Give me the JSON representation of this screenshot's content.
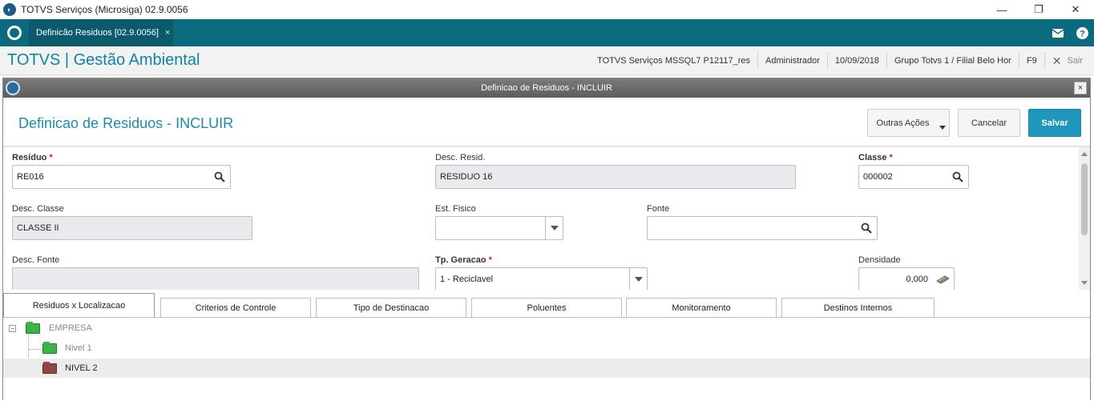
{
  "window": {
    "title": "TOTVS Serviços (Microsiga) 02.9.0056",
    "minimize": "—",
    "maximize": "❐",
    "close": "✕"
  },
  "tabbar": {
    "active_tab": "Definicão Residuos [02.9.0056]",
    "tab_close": "×"
  },
  "header": {
    "brand": "TOTVS | Gestão Ambiental",
    "environment": "TOTVS Serviços MSSQL7 P12117_res",
    "user": "Administrador",
    "date": "10/09/2018",
    "branch": "Grupo Totvs 1 / Filial Belo Hor",
    "shortcut": "F9",
    "exit_icon": "✕",
    "exit_label": "Sair"
  },
  "dialog": {
    "title": "Definicao de Residuos - INCLUIR",
    "close": "×",
    "form_title": "Definicao de Residuos - INCLUIR",
    "buttons": {
      "more_actions": "Outras Ações",
      "cancel": "Cancelar",
      "save": "Salvar"
    }
  },
  "fields": {
    "residuo": {
      "label": "Resíduo",
      "required": "*",
      "value": "RE016"
    },
    "desc_resid": {
      "label": "Desc. Resid.",
      "value": "RESIDUO 16"
    },
    "classe": {
      "label": "Classe",
      "required": "*",
      "value": "000002"
    },
    "desc_classe": {
      "label": "Desc. Classe",
      "value": "CLASSE II"
    },
    "est_fisico": {
      "label": "Est. Fisico",
      "value": ""
    },
    "fonte": {
      "label": "Fonte",
      "value": ""
    },
    "desc_fonte": {
      "label": "Desc. Fonte",
      "value": ""
    },
    "tp_geracao": {
      "label": "Tp. Geracao",
      "required": "*",
      "value": "1 - Reciclavel"
    },
    "densidade": {
      "label": "Densidade",
      "value": "0,000"
    }
  },
  "tabs": [
    {
      "label": "Residuos x Localizacao"
    },
    {
      "label": "Criterios de Controle"
    },
    {
      "label": "Tipo de Destinacao"
    },
    {
      "label": "Poluentes"
    },
    {
      "label": "Monitoramento"
    },
    {
      "label": "Destinos Internos"
    }
  ],
  "tree": {
    "toggle": "−",
    "root": {
      "label": "EMPRESA"
    },
    "children": [
      {
        "label": "Nivel 1"
      },
      {
        "label": "NIVEL 2"
      }
    ]
  },
  "colors": {
    "tab_bar": "#0c6a7f",
    "brand": "#0e84a3",
    "primary_button": "#1f97bb",
    "required": "#d9231f",
    "folder_green": "#3db346",
    "folder_red": "#8e4646"
  }
}
